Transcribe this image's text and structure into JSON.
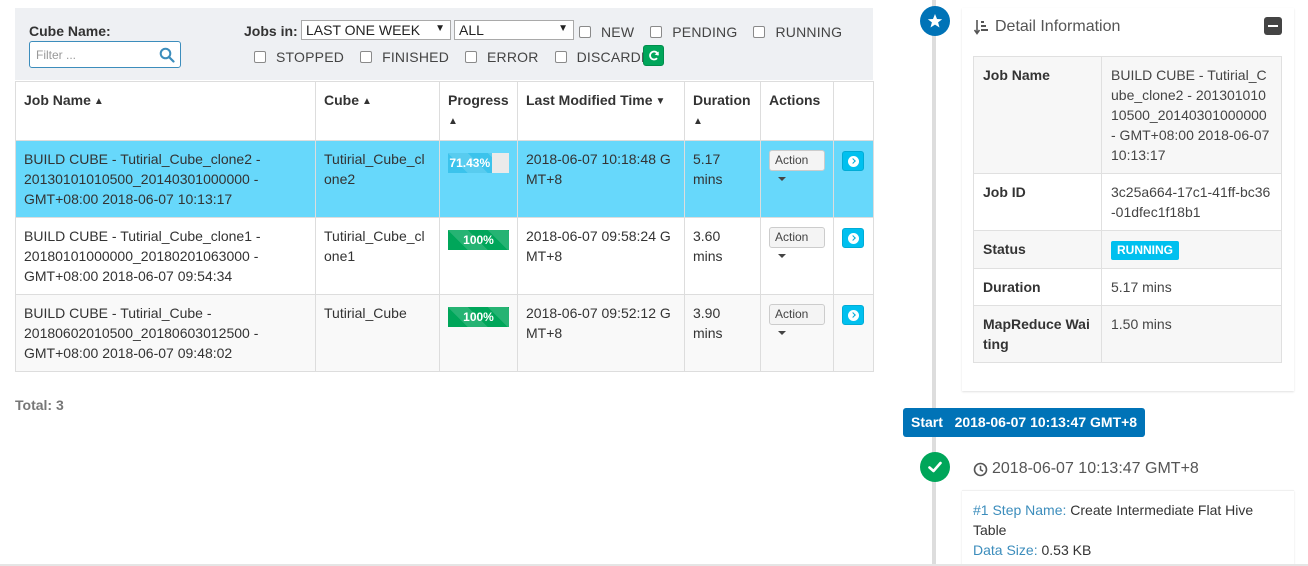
{
  "filters": {
    "cube_name_label": "Cube Name:",
    "filter_placeholder": "Filter ...",
    "jobs_in_label": "Jobs in:",
    "time_range_selected": "LAST ONE WEEK",
    "status_selected": "ALL",
    "checkboxes_row1": [
      "NEW",
      "PENDING",
      "RUNNING"
    ],
    "checkboxes_row2": [
      "STOPPED",
      "FINISHED",
      "ERROR",
      "DISCARDED"
    ]
  },
  "table": {
    "headers": {
      "job_name": "Job Name",
      "cube": "Cube",
      "progress": "Progress",
      "last_modified": "Last Modified Time",
      "duration": "Duration",
      "actions": "Actions"
    },
    "rows": [
      {
        "job_name": "BUILD CUBE - Tutirial_Cube_clone2 - 20130101010500_20140301000000 - GMT+08:00 2018-06-07 10:13:17",
        "cube": "Tutirial_Cube_clone2",
        "progress_label": "71.43%",
        "progress_value": 71.43,
        "last_modified": "2018-06-07 10:18:48 GMT+8",
        "duration": "5.17 mins",
        "action_label": "Action"
      },
      {
        "job_name": "BUILD CUBE - Tutirial_Cube_clone1 - 20180101000000_20180201063000 - GMT+08:00 2018-06-07 09:54:34",
        "cube": "Tutirial_Cube_clone1",
        "progress_label": "100%",
        "progress_value": 100,
        "last_modified": "2018-06-07 09:58:24 GMT+8",
        "duration": "3.60 mins",
        "action_label": "Action"
      },
      {
        "job_name": "BUILD CUBE - Tutirial_Cube - 20180602010500_20180603012500 - GMT+08:00 2018-06-07 09:48:02",
        "cube": "Tutirial_Cube",
        "progress_label": "100%",
        "progress_value": 100,
        "last_modified": "2018-06-07 09:52:12 GMT+8",
        "duration": "3.90 mins",
        "action_label": "Action"
      }
    ],
    "total": "Total: 3"
  },
  "detail": {
    "title": "Detail Information",
    "job_name_key": "Job Name",
    "job_name_value": "BUILD CUBE - Tutirial_Cube_clone2 - 20130101010500_20140301000000 - GMT+08:00 2018-06-07 10:13:17",
    "job_id_key": "Job ID",
    "job_id_value": "3c25a664-17c1-41ff-bc36-01dfec1f18b1",
    "status_key": "Status",
    "status_value": "RUNNING",
    "duration_key": "Duration",
    "duration_value": "5.17 mins",
    "mr_wait_key": "MapReduce Waiting",
    "mr_wait_value": "1.50 mins"
  },
  "timeline": {
    "start_label": "Start",
    "start_time": "2018-06-07 10:13:47 GMT+8",
    "step_time": "2018-06-07 10:13:47 GMT+8",
    "step_name_label": "#1 Step Name:",
    "step_name_value": "Create Intermediate Flat Hive Table",
    "data_size_label": "Data Size:",
    "data_size_value": "0.53 KB"
  },
  "colors": {
    "selected_row": "#67d8fb",
    "progress_running": "#3bc3ec",
    "progress_done": "#00a65a",
    "timeline_blue": "#0073b7",
    "timeline_green": "#00a65a",
    "status_running": "#00c0ef"
  }
}
